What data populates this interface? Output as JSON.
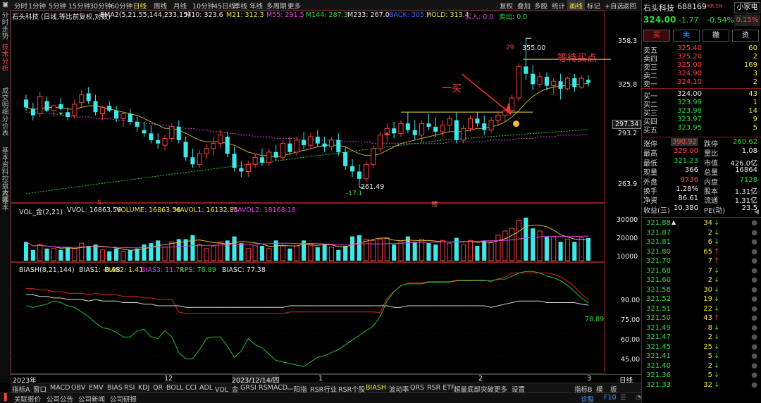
{
  "toolbar": {
    "timeframes": [
      "分时",
      "1分钟",
      "5分钟",
      "15分钟",
      "30分钟",
      "60分钟",
      "日线",
      "周线",
      "月线",
      "10分钟",
      "45日线",
      "季线",
      "年线",
      "多周期",
      "更多"
    ],
    "active_timeframe": "日线",
    "right_buttons": [
      "复权",
      "叠加",
      "多股",
      "统计",
      "画线",
      "标记",
      "+自选",
      "返回"
    ],
    "active_right": "画线"
  },
  "left_tabs": [
    "分时走势",
    "技术分析",
    "基本资料",
    "分价表",
    "行情明细",
    "控盘大师",
    "控基本"
  ],
  "active_left_tab": "技术分析",
  "chart_header": {
    "title": "石头科技 (日线,等比前复权,对数)",
    "ema": "EMA2(5,21,55,144,233,15)",
    "m10": "M10: 323.6",
    "m21": "M21: 312.3",
    "m55": "M55: 291.5",
    "m144": "M144: 287.3",
    "m233": "M233: 267.0",
    "back": "BACK: 305.7",
    "hold": "HOLD: 313.4",
    "buy": "买入: 0.0",
    "sell": "卖出: 0.0"
  },
  "price_axis": [
    "358.3",
    "325.8",
    "293.2",
    "263.9"
  ],
  "current_price_tag": "297.34",
  "annotations": {
    "buy_one": "一买",
    "wait_buy": "等待买点",
    "high": "355.00",
    "high_prefix": "29",
    "low": "261.49",
    "low_pct": "-17.1",
    "s_marker": "S"
  },
  "volume_header": {
    "label": "VOL_金(2,21)",
    "vvol": "VVOL: 16863.56",
    "volume": "VOLUME: 16863.56",
    "mavol1": "MAVOL1: 16132.85",
    "mavol2": "MAVOL2: 18168.18"
  },
  "volume_axis": [
    "30000",
    "20000",
    "10000"
  ],
  "bias_header": {
    "label": "BIASH(8,21,144)",
    "bias1": "BIAS1: -0.98",
    "bias2": "BIAS2: 1.41",
    "bias3": "BIAS3: 11.74",
    "rps": "RPS: 78.89",
    "biasc": "BIASC: 77.38"
  },
  "bias_axis": [
    "90.00",
    "75.00",
    "60.00",
    "45.00"
  ],
  "bias_last": "78.89",
  "date_axis": [
    "2023年",
    "12",
    "2023/12/14/四",
    "1",
    "2",
    "3"
  ],
  "date_right": "日线",
  "bottom_tabs": [
    "指标A",
    "窗口",
    "MACD",
    "OBV",
    "EMV",
    "BIAS",
    "RSI",
    "KDJ",
    "QR",
    "BOLL",
    "CCI",
    "ADL",
    "VOL_金",
    "GRSI",
    "RSMACD",
    "一阳指",
    "RSR行业",
    "RSR个股",
    "BIASH",
    "波动率",
    "QRS",
    "RSR ETF",
    "超量底部突破",
    "更多",
    "设置"
  ],
  "active_bottom_tab": "BIASH",
  "bottom_right": [
    "指标B",
    "模",
    "板"
  ],
  "status_bar": [
    "关联报价",
    "公司公告",
    "公司新闻",
    "公司研报"
  ],
  "status_right": [
    "诊股",
    "F10"
  ],
  "stock": {
    "name": "石头科技",
    "code": "688169",
    "tag": "KR 5N",
    "badge": "小家电",
    "price": "324.00",
    "change": "-1.77",
    "change_pct": "-0.54%",
    "ratio": "0.15%",
    "buttons": [
      "买",
      "卖",
      "撤",
      "资"
    ]
  },
  "asks": [
    {
      "label": "卖五",
      "price": "325.40",
      "vol": "60"
    },
    {
      "label": "卖四",
      "price": "325.20",
      "vol": "2"
    },
    {
      "label": "卖三",
      "price": "325.00",
      "vol": "169"
    },
    {
      "label": "卖二",
      "price": "324.90",
      "vol": "3"
    },
    {
      "label": "卖一",
      "price": "324.10",
      "vol": "2"
    }
  ],
  "bids": [
    {
      "label": "买一",
      "price": "324.00",
      "vol": "43"
    },
    {
      "label": "买二",
      "price": "323.99",
      "vol": "1"
    },
    {
      "label": "买三",
      "price": "323.98",
      "vol": "14"
    },
    {
      "label": "买四",
      "price": "323.97",
      "vol": "9"
    },
    {
      "label": "买五",
      "price": "323.95",
      "vol": "5"
    }
  ],
  "stats": [
    {
      "k1": "涨停",
      "v1": "390.92",
      "k2": "跌停",
      "v2": "260.62"
    },
    {
      "k1": "最高",
      "v1": "329.00",
      "k2": "量比",
      "v2": "1.08"
    },
    {
      "k1": "最低",
      "v1": "321.23",
      "k2": "市值",
      "v2": "426.0亿"
    },
    {
      "k1": "现量",
      "v1": "366",
      "k2": "总量",
      "v2": "16864"
    },
    {
      "k1": "外盘",
      "v1": "9736",
      "k2": "内盘",
      "v2": "7128"
    },
    {
      "k1": "换手",
      "v1": "1.28%",
      "k2": "股本",
      "v2": "1.31亿"
    },
    {
      "k1": "净资",
      "v1": "86.61",
      "k2": "流通",
      "v2": "1.31亿"
    },
    {
      "k1": "收益(三)",
      "v1": "10.380",
      "k2": "PE(动)",
      "v2": "23.5"
    }
  ],
  "ticks": [
    {
      "price": "321.88",
      "vol": "34",
      "dir": "sell",
      "arrow": true
    },
    {
      "price": "321.87",
      "vol": "2",
      "dir": "sell"
    },
    {
      "price": "321.81",
      "vol": "6",
      "dir": "sell"
    },
    {
      "price": "321.80",
      "vol": "65",
      "dir": "buy"
    },
    {
      "price": "321.70",
      "vol": "7",
      "dir": "buy"
    },
    {
      "price": "321.68",
      "vol": "7",
      "dir": "sell"
    },
    {
      "price": "321.60",
      "vol": "2",
      "dir": "sell"
    },
    {
      "price": "321.58",
      "vol": "30",
      "dir": "sell"
    },
    {
      "price": "321.52",
      "vol": "19",
      "dir": "sell"
    },
    {
      "price": "321.51",
      "vol": "22",
      "dir": "sell"
    },
    {
      "price": "321.50",
      "vol": "43",
      "dir": "buy"
    },
    {
      "price": "321.49",
      "vol": "8",
      "dir": "sell"
    },
    {
      "price": "321.47",
      "vol": "2",
      "dir": "sell"
    },
    {
      "price": "321.45",
      "vol": "25",
      "dir": "sell"
    },
    {
      "price": "321.41",
      "vol": "5",
      "dir": "sell"
    },
    {
      "price": "321.40",
      "vol": "2",
      "dir": "sell"
    },
    {
      "price": "321.36",
      "vol": "5",
      "dir": "sell"
    },
    {
      "price": "321.33",
      "vol": "32",
      "dir": "sell"
    }
  ],
  "colors": {
    "up": "#ff4040",
    "down": "#3fe8e8",
    "text": "#c8c8c8",
    "accent": "#f0e040"
  },
  "chart_data": {
    "type": "candlestick",
    "ohlc": [
      [
        313,
        316,
        306,
        308
      ],
      [
        307,
        311,
        300,
        303
      ],
      [
        304,
        318,
        302,
        315
      ],
      [
        312,
        315,
        305,
        306
      ],
      [
        306,
        310,
        302,
        309
      ],
      [
        310,
        314,
        306,
        307
      ],
      [
        305,
        308,
        300,
        302
      ],
      [
        303,
        313,
        301,
        310
      ],
      [
        311,
        319,
        308,
        316
      ],
      [
        317,
        321,
        310,
        312
      ],
      [
        312,
        316,
        303,
        305
      ],
      [
        304,
        309,
        300,
        308
      ],
      [
        309,
        312,
        305,
        306
      ],
      [
        306,
        309,
        299,
        301
      ],
      [
        301,
        305,
        296,
        304
      ],
      [
        304,
        307,
        297,
        299
      ],
      [
        299,
        302,
        293,
        296
      ],
      [
        294,
        299,
        290,
        292
      ],
      [
        292,
        297,
        286,
        288
      ],
      [
        288,
        292,
        283,
        286
      ],
      [
        285,
        291,
        282,
        289
      ],
      [
        289,
        298,
        287,
        296
      ],
      [
        296,
        300,
        286,
        288
      ],
      [
        287,
        290,
        276,
        278
      ],
      [
        278,
        283,
        272,
        274
      ],
      [
        274,
        282,
        272,
        280
      ],
      [
        280,
        286,
        277,
        283
      ],
      [
        283,
        290,
        279,
        286
      ],
      [
        286,
        294,
        283,
        291
      ],
      [
        290,
        293,
        278,
        280
      ],
      [
        280,
        284,
        270,
        272
      ],
      [
        272,
        276,
        267,
        270
      ],
      [
        270,
        276,
        267,
        274
      ],
      [
        274,
        280,
        272,
        278
      ],
      [
        278,
        283,
        273,
        275
      ],
      [
        275,
        283,
        273,
        281
      ],
      [
        281,
        285,
        276,
        278
      ],
      [
        278,
        288,
        276,
        286
      ],
      [
        286,
        290,
        279,
        281
      ],
      [
        281,
        290,
        279,
        288
      ],
      [
        288,
        293,
        283,
        285
      ],
      [
        285,
        292,
        283,
        290
      ],
      [
        290,
        294,
        284,
        286
      ],
      [
        286,
        290,
        281,
        284
      ],
      [
        284,
        290,
        282,
        288
      ],
      [
        288,
        292,
        279,
        281
      ],
      [
        281,
        284,
        271,
        273
      ],
      [
        273,
        277,
        267,
        270
      ],
      [
        270,
        274,
        261.49,
        266
      ],
      [
        266,
        276,
        264,
        274
      ],
      [
        274,
        285,
        272,
        283
      ],
      [
        283,
        293,
        281,
        291
      ],
      [
        291,
        298,
        287,
        295
      ],
      [
        295,
        299,
        289,
        292
      ],
      [
        292,
        300,
        290,
        298
      ],
      [
        298,
        305,
        292,
        294
      ],
      [
        294,
        300,
        288,
        291
      ],
      [
        291,
        300,
        287,
        298
      ],
      [
        298,
        304,
        294,
        296
      ],
      [
        296,
        302,
        290,
        293
      ],
      [
        293,
        300,
        290,
        297
      ],
      [
        297,
        303,
        293,
        301
      ],
      [
        300,
        305,
        286,
        288
      ],
      [
        288,
        297,
        286,
        295
      ],
      [
        295,
        303,
        293,
        301
      ],
      [
        301,
        305,
        296,
        298
      ],
      [
        298,
        303,
        291,
        294
      ],
      [
        294,
        302,
        292,
        300
      ],
      [
        300,
        305,
        297,
        303
      ],
      [
        303,
        308,
        299,
        306
      ],
      [
        306,
        316,
        305,
        314
      ],
      [
        314,
        337,
        312,
        335
      ],
      [
        335,
        355,
        326,
        330
      ],
      [
        330,
        336,
        319,
        323
      ],
      [
        323,
        331,
        321,
        328
      ],
      [
        328,
        331,
        319,
        322
      ],
      [
        322,
        327,
        316,
        325
      ],
      [
        325,
        330,
        313,
        320
      ],
      [
        320,
        328,
        319,
        327
      ],
      [
        327,
        330,
        318,
        321
      ],
      [
        321,
        329,
        320,
        327
      ],
      [
        325.9,
        329,
        321.23,
        324
      ]
    ],
    "ma_yellow": [
      308,
      307,
      307,
      308,
      308,
      308,
      307,
      307,
      308,
      309,
      309,
      308,
      307,
      306,
      305,
      304,
      303,
      301,
      299,
      297,
      295,
      295,
      294,
      292,
      290,
      288,
      287,
      287,
      287,
      286,
      285,
      283,
      281,
      280,
      279,
      279,
      278,
      279,
      280,
      281,
      282,
      283,
      284,
      285,
      285,
      285,
      284,
      282,
      280,
      279,
      279,
      280,
      282,
      284,
      286,
      287,
      288,
      289,
      290,
      291,
      292,
      293,
      293,
      293,
      294,
      295,
      295,
      296,
      297,
      299,
      302,
      306,
      311,
      315,
      318,
      320,
      321,
      322,
      322,
      323,
      323,
      323.6
    ],
    "ma_magenta": [
      305,
      305,
      304,
      304,
      304,
      303,
      303,
      302,
      302,
      302,
      301,
      301,
      301,
      300,
      300,
      299,
      299,
      298,
      298,
      297,
      297,
      296,
      296,
      295,
      295,
      294,
      294,
      293,
      293,
      292,
      292,
      291,
      291,
      290,
      290,
      290,
      289,
      289,
      289,
      289,
      288,
      288,
      288,
      288,
      288,
      288,
      287,
      287,
      287,
      287,
      286,
      286,
      286,
      286,
      286,
      286,
      286,
      286,
      286,
      286,
      286,
      287,
      287,
      287,
      287,
      287,
      287,
      288,
      288,
      288,
      288,
      289,
      289,
      289,
      290,
      290,
      290,
      291,
      291,
      291,
      291,
      291.5
    ],
    "ma_green": [
      258,
      258.5,
      259,
      259.5,
      260,
      260.5,
      261,
      261.5,
      262,
      262.5,
      263,
      263.5,
      264,
      264.5,
      265,
      265.5,
      266,
      266.5,
      267,
      267.5,
      268,
      268.5,
      269,
      269.5,
      270,
      270.5,
      271,
      271.5,
      272,
      272.5,
      273,
      273.5,
      274,
      274.5,
      275,
      275.5,
      276,
      276.5,
      277,
      277.5,
      278,
      278.5,
      279,
      279.5,
      280,
      280.5,
      281,
      281.5,
      282,
      282.5,
      283,
      283.5,
      284,
      284.5,
      285,
      285.5,
      286,
      286.5,
      287,
      287.5,
      288,
      288.3,
      288.6,
      288.9,
      289.2,
      289.5,
      289.8,
      290.1,
      290.4,
      290.7,
      291,
      291.3,
      291.6,
      291.9,
      292.2,
      292.5,
      292.8,
      293.1,
      293.4,
      293.7,
      294,
      294.2
    ],
    "volume": [
      14000,
      8000,
      12000,
      9000,
      9000,
      8000,
      10000,
      9000,
      13000,
      11000,
      12000,
      8000,
      7000,
      9000,
      7000,
      8000,
      9000,
      12000,
      13000,
      15000,
      10000,
      14000,
      16000,
      16000,
      19000,
      12000,
      9000,
      11000,
      14000,
      15000,
      18000,
      13000,
      9000,
      11000,
      11000,
      9000,
      15000,
      11000,
      9000,
      11000,
      15000,
      12000,
      10000,
      12000,
      10000,
      8000,
      11000,
      18000,
      19000,
      16000,
      15000,
      16000,
      17000,
      12000,
      14000,
      18000,
      14000,
      16000,
      13000,
      12000,
      15000,
      13000,
      17000,
      12000,
      15000,
      11000,
      15000,
      14000,
      19000,
      22000,
      24000,
      30000,
      32000,
      24000,
      22000,
      18000,
      18000,
      14000,
      16000,
      14000,
      17000,
      16863
    ],
    "rps": [
      77,
      76,
      77,
      78,
      80,
      79,
      77,
      76,
      73,
      70,
      66,
      63,
      62,
      60,
      57,
      57,
      61,
      62,
      57,
      56,
      61,
      57,
      47,
      43,
      43,
      49,
      56,
      57,
      57,
      51,
      44,
      48,
      56,
      52,
      50,
      46,
      42,
      41,
      40,
      39,
      38,
      41,
      44,
      45,
      47,
      49,
      52,
      55,
      58,
      61,
      64,
      70,
      80,
      86,
      90,
      91,
      91,
      91,
      92,
      92,
      92,
      92,
      93,
      93,
      93,
      93,
      93,
      93,
      94,
      94,
      96,
      98,
      99,
      99,
      98,
      96,
      95,
      93,
      90,
      86,
      82,
      78.89
    ],
    "biasc": [
      84,
      84,
      83,
      83,
      82,
      82,
      81,
      81,
      81,
      80,
      81,
      80,
      80,
      80,
      79,
      79,
      79,
      78,
      78,
      77,
      77,
      77,
      77,
      76,
      76,
      76,
      76,
      76,
      76,
      76,
      76,
      76,
      76,
      76,
      76,
      76,
      76,
      76,
      77,
      77,
      77,
      77,
      77,
      77,
      77,
      77,
      77,
      77,
      77,
      77,
      77,
      77,
      77,
      76,
      76,
      77,
      77,
      77,
      77,
      77,
      77,
      77,
      77,
      77,
      77,
      77,
      77,
      76,
      77,
      78,
      79,
      80,
      80,
      80,
      80,
      79,
      79,
      79,
      79,
      79,
      78,
      77.38
    ],
    "ylim": [
      255,
      365
    ],
    "vol_ylim": [
      0,
      34000
    ],
    "bias_ylim": [
      35,
      100
    ]
  }
}
